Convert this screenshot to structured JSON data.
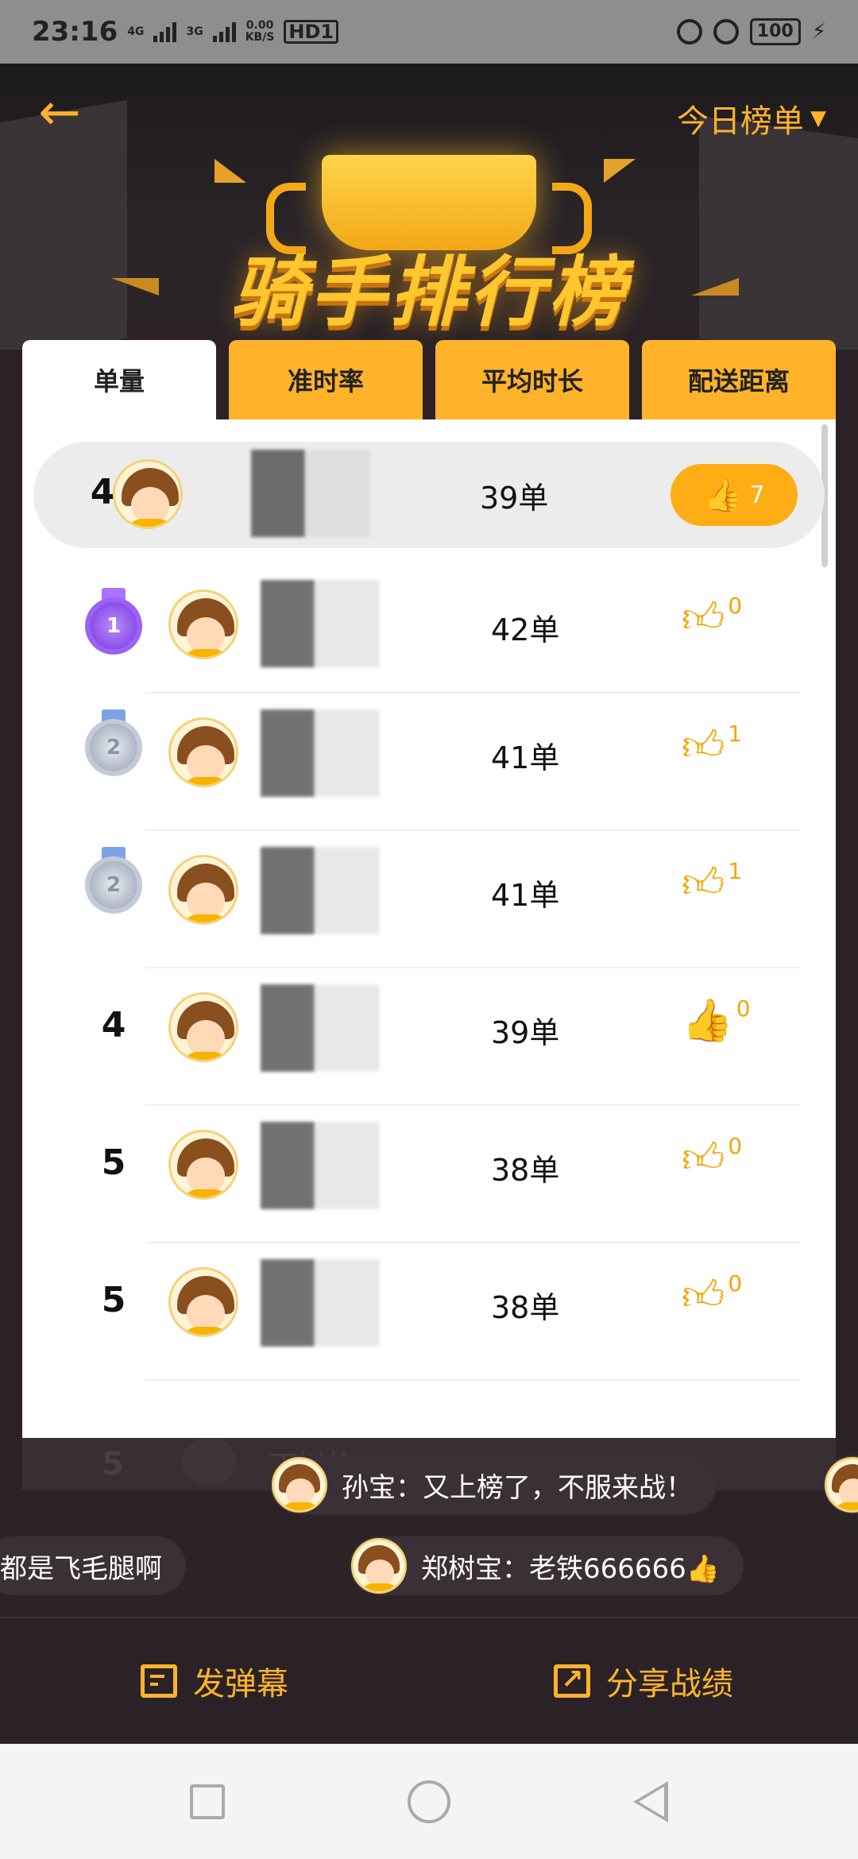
{
  "status_bar": {
    "time": "23:16",
    "network_speed": "0.00",
    "network_unit": "KB/S",
    "net1": "4G",
    "net2": "3G",
    "hd": "HD1",
    "battery": "100"
  },
  "header": {
    "title": "骑手排行榜",
    "period_label": "今日榜单"
  },
  "tabs": [
    {
      "label": "单量",
      "active": true
    },
    {
      "label": "准时率",
      "active": false
    },
    {
      "label": "平均时长",
      "active": false
    },
    {
      "label": "配送距离",
      "active": false
    }
  ],
  "my_row": {
    "rank": "4",
    "count": "39单",
    "likes": "7"
  },
  "rows": [
    {
      "rank_type": "medal",
      "medal_color": "purple",
      "medal_num": "1",
      "count": "42单",
      "likes": "0",
      "liked": false
    },
    {
      "rank_type": "medal",
      "medal_color": "silver",
      "medal_num": "2",
      "count": "41单",
      "likes": "1",
      "liked": false
    },
    {
      "rank_type": "medal",
      "medal_color": "silver",
      "medal_num": "2",
      "count": "41单",
      "likes": "1",
      "liked": false
    },
    {
      "rank_type": "number",
      "rank": "4",
      "count": "39单",
      "likes": "0",
      "liked": true
    },
    {
      "rank_type": "number",
      "rank": "5",
      "count": "38单",
      "likes": "0",
      "liked": false
    },
    {
      "rank_type": "number",
      "rank": "5",
      "count": "38单",
      "likes": "0",
      "liked": false
    }
  ],
  "ghost_row": {
    "rank": "5",
    "text": "丁树佳"
  },
  "danmaku": [
    {
      "text": "孙宝：又上榜了，不服来战！"
    },
    {
      "text": "郑树宝：老铁666666👍"
    },
    {
      "text": "都是飞毛腿啊"
    }
  ],
  "actions": {
    "danmaku_label": "发弹幕",
    "share_label": "分享战绩"
  },
  "colors": {
    "accent": "#ffb32b",
    "background": "#2a2226",
    "card": "#ffffff"
  }
}
